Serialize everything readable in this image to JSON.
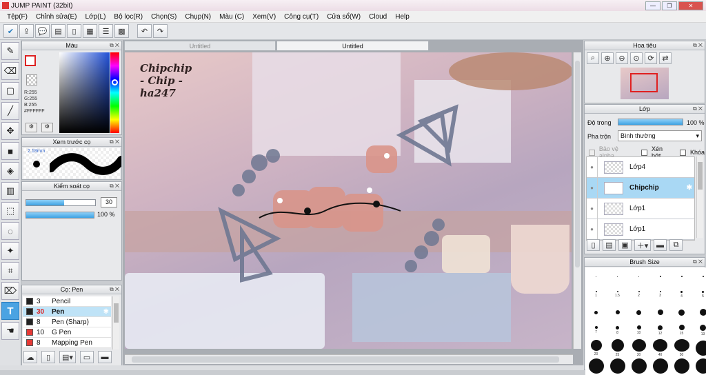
{
  "window": {
    "title": "JUMP PAINT (32bit)"
  },
  "menu": [
    "Tệp(F)",
    "Chỉnh sửa(E)",
    "Lớp(L)",
    "Bộ lọc(R)",
    "Chọn(S)",
    "Chụp(N)",
    "Màu (C)",
    "Xem(V)",
    "Công cụ(T)",
    "Cửa sổ(W)",
    "Cloud",
    "Help"
  ],
  "color_panel": {
    "title": "Màu",
    "r": "R:255",
    "g": "G:255",
    "b": "B:255",
    "hex": "#FFFFFF"
  },
  "brush_preview": {
    "title": "Xem trước cọ",
    "size": "2.18mm"
  },
  "brush_control": {
    "title": "Kiểm soát cọ",
    "size_value": "30",
    "size_fraction": 0.55,
    "opacity_value": "100 %",
    "opacity_fraction": 1.0
  },
  "brush_list": {
    "title": "Cọ: Pen",
    "items": [
      {
        "size": "3",
        "name": "Pencil",
        "color": "#222222"
      },
      {
        "size": "30",
        "name": "Pen",
        "color": "#222222",
        "selected": true
      },
      {
        "size": "8",
        "name": "Pen (Sharp)",
        "color": "#222222"
      },
      {
        "size": "10",
        "name": "G Pen",
        "color": "#e53935"
      },
      {
        "size": "8",
        "name": "Mapping Pen",
        "color": "#e53935"
      }
    ]
  },
  "tabs": [
    "Untitled",
    "Untitled"
  ],
  "artwork": {
    "watermark_lines": [
      "Chipchip",
      "- Chip -",
      "ha247"
    ]
  },
  "navigator": {
    "title": "Hoa tiêu"
  },
  "layers": {
    "title": "Lớp",
    "opacity_label": "Độ trong",
    "opacity_value": "100 %",
    "opacity_fraction": 1.0,
    "blend_label": "Pha trộn",
    "blend_value": "Bình thường",
    "protect_alpha": "Bảo vệ alpha",
    "clipping": "Xén bớt",
    "lock": "Khóa",
    "items": [
      {
        "name": "Lớp4"
      },
      {
        "name": "Chipchip",
        "selected": true
      },
      {
        "name": "Lớp1"
      },
      {
        "name": "Lớp1"
      }
    ]
  },
  "brush_size": {
    "title": "Brush Size",
    "cells": [
      {
        "label": "",
        "d": 1
      },
      {
        "label": "",
        "d": 1
      },
      {
        "label": "",
        "d": 1
      },
      {
        "label": "",
        "d": 2
      },
      {
        "label": "",
        "d": 2
      },
      {
        "label": "",
        "d": 2
      },
      {
        "label": "1",
        "d": 2
      },
      {
        "label": "1.5",
        "d": 2
      },
      {
        "label": "2",
        "d": 2
      },
      {
        "label": "3",
        "d": 2
      },
      {
        "label": "4",
        "d": 3
      },
      {
        "label": "5",
        "d": 3
      },
      {
        "label": "",
        "d": 5
      },
      {
        "label": "",
        "d": 6
      },
      {
        "label": "",
        "d": 7
      },
      {
        "label": "",
        "d": 8
      },
      {
        "label": "",
        "d": 9
      },
      {
        "label": "",
        "d": 10
      },
      {
        "label": "7",
        "d": 4
      },
      {
        "label": "8",
        "d": 5
      },
      {
        "label": "10",
        "d": 6
      },
      {
        "label": "12",
        "d": 7
      },
      {
        "label": "15",
        "d": 8
      },
      {
        "label": "13",
        "d": 9
      },
      {
        "label": "20",
        "d": 16
      },
      {
        "label": "25",
        "d": 18
      },
      {
        "label": "30",
        "d": 20
      },
      {
        "label": "40",
        "d": 21
      },
      {
        "label": "50",
        "d": 22
      },
      {
        "label": "",
        "d": 22
      },
      {
        "label": "",
        "d": 22
      },
      {
        "label": "",
        "d": 22
      },
      {
        "label": "",
        "d": 22
      },
      {
        "label": "",
        "d": 22
      },
      {
        "label": "",
        "d": 22
      },
      {
        "label": "",
        "d": 22
      }
    ]
  }
}
